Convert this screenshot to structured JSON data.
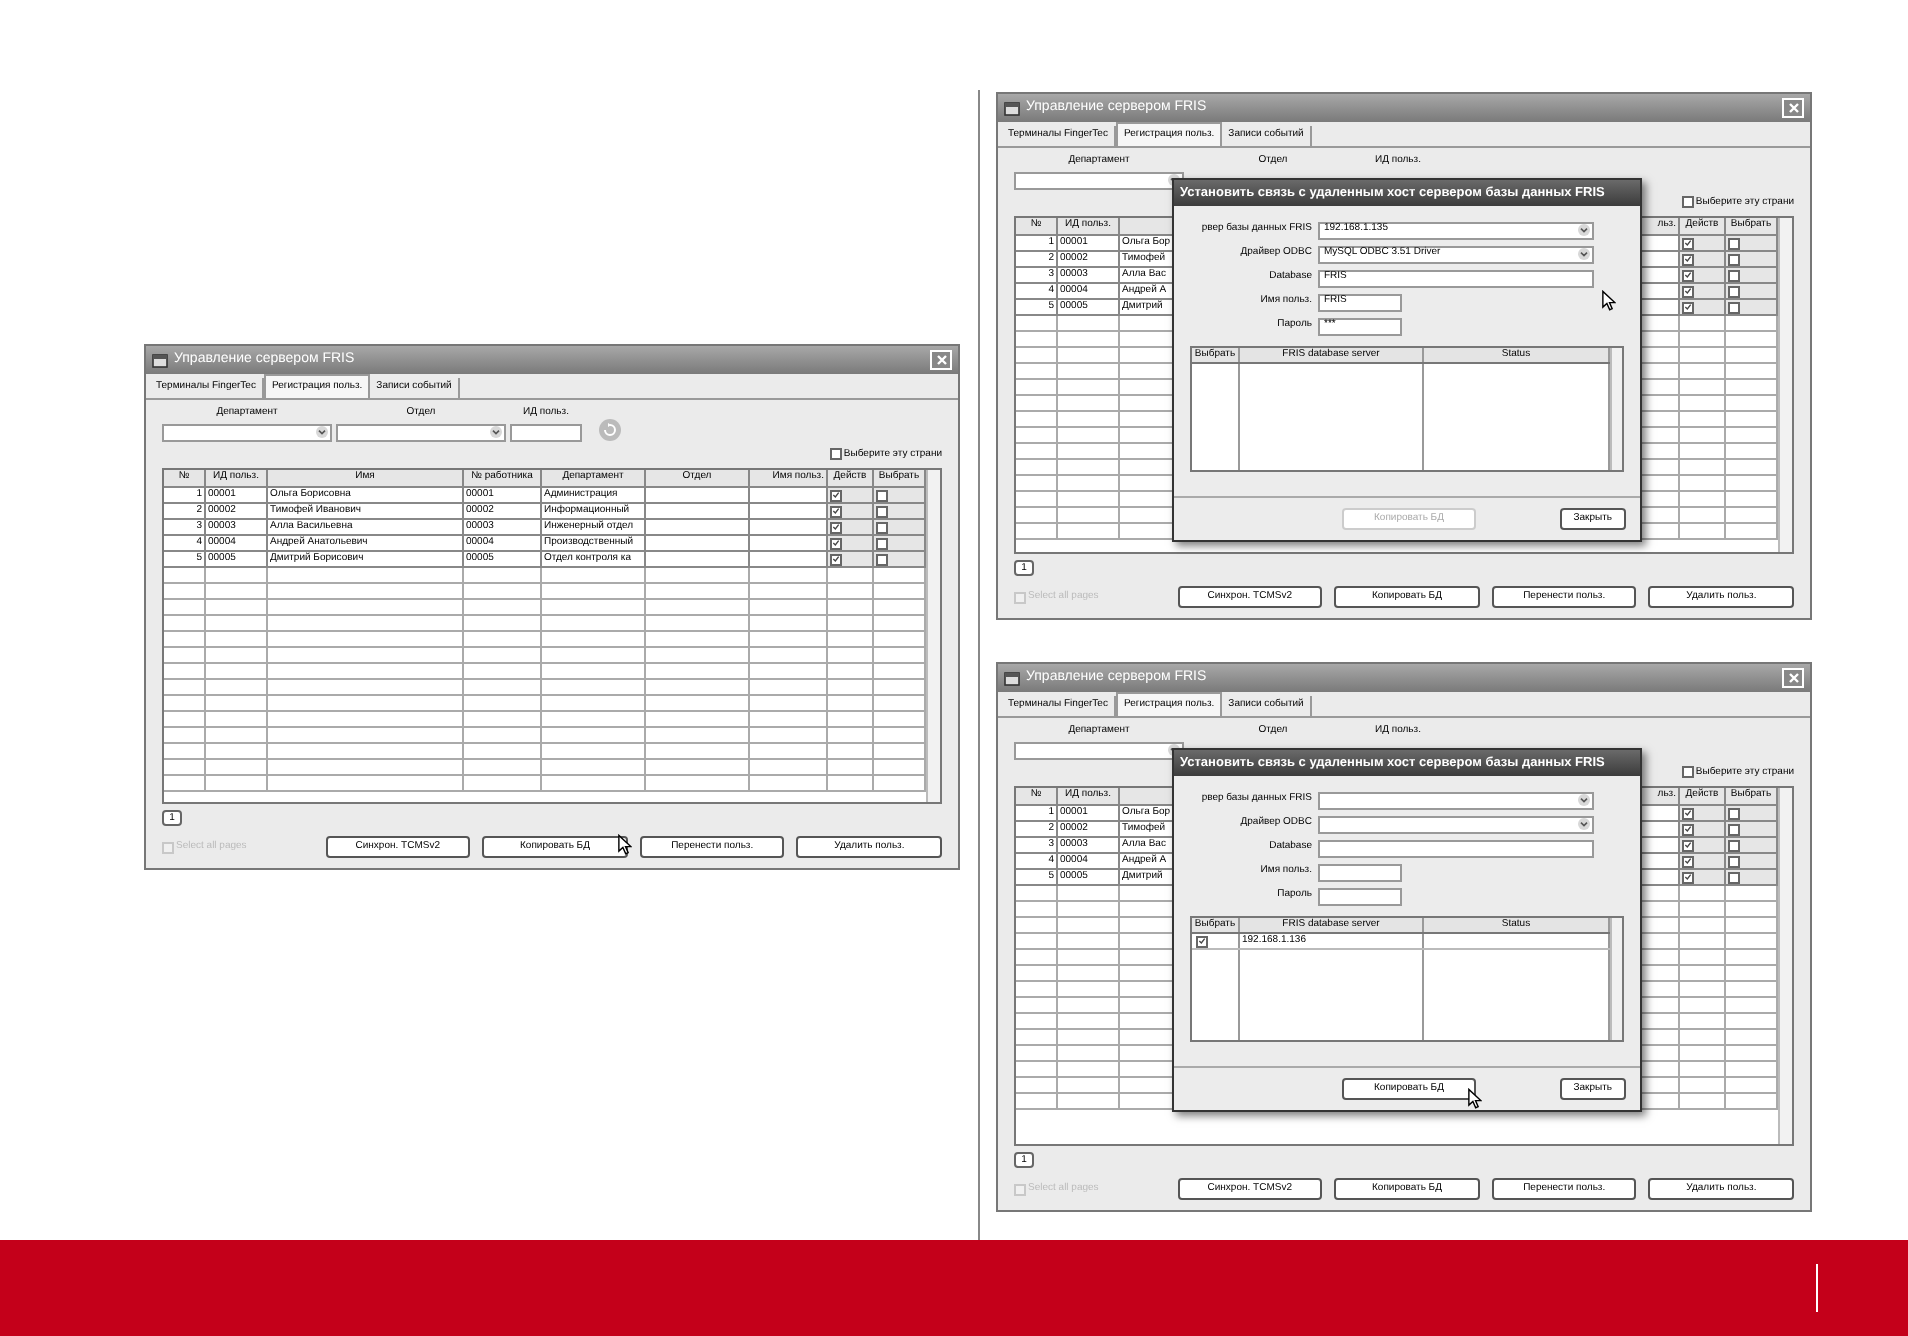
{
  "windows": [
    {
      "title": "Управление сервером FRIS",
      "tabs": [
        {
          "label": "Терминалы FingerTec",
          "selected": false
        },
        {
          "label": "Регистрация польз.",
          "selected": true
        },
        {
          "label": "Записи событий",
          "selected": false
        }
      ],
      "filters": {
        "department_label": "Департамент",
        "section_label": "Отдел",
        "user_id_label": "ИД польз."
      },
      "select_page": {
        "label": "Выберите эту страни",
        "checked": false
      },
      "table": {
        "columns": [
          {
            "label": "№"
          },
          {
            "label": "ИД польз."
          },
          {
            "label": "Имя"
          },
          {
            "label": "№ работника"
          },
          {
            "label": "Департамент"
          },
          {
            "label": "Отдел"
          },
          {
            "label": "Имя польз."
          },
          {
            "label": "Действ"
          },
          {
            "label": "Выбрать"
          }
        ],
        "rows": [
          {
            "no": "1",
            "id": "00001",
            "name": "Ольга Борисовна",
            "employee": "00001",
            "department": "Администрация",
            "checked": true,
            "selected": false
          },
          {
            "no": "2",
            "id": "00002",
            "name": "Тимофей Иванович",
            "employee": "00002",
            "department": "Информационный",
            "checked": true,
            "selected": false
          },
          {
            "no": "3",
            "id": "00003",
            "name": "Алла Васильевна",
            "employee": "00003",
            "department": "Инженерный отдел",
            "checked": true,
            "selected": false
          },
          {
            "no": "4",
            "id": "00004",
            "name": "Андрей Анатольевич",
            "employee": "00004",
            "department": "Производственный",
            "checked": true,
            "selected": false
          },
          {
            "no": "5",
            "id": "00005",
            "name": "Дмитрий Борисович",
            "employee": "00005",
            "department": "Отдел контроля ка",
            "checked": true,
            "selected": false
          }
        ]
      },
      "page_button": "1",
      "select_all": {
        "label": "Select all pages",
        "checked": false,
        "disabled": true
      },
      "buttons": [
        "Синхрон. TCMSv2",
        "Копировать БД",
        "Перенести польз.",
        "Удалить польз."
      ]
    },
    {
      "title": "Управление сервером FRIS",
      "tabs": [
        {
          "label": "Терминалы FingerTec",
          "selected": false
        },
        {
          "label": "Регистрация польз.",
          "selected": true
        },
        {
          "label": "Записи событий",
          "selected": false
        }
      ],
      "filters": {
        "department_label": "Департамент",
        "section_label": "Отдел",
        "user_id_label": "ИД польз."
      },
      "select_page": {
        "label": "Выберите эту страни",
        "checked": false
      },
      "table": {
        "columns": [
          {
            "label": "№"
          },
          {
            "label": "ИД польз."
          },
          {},
          {},
          {},
          {},
          {
            "label": "льз."
          },
          {
            "label": "Действ"
          },
          {
            "label": "Выбрать"
          }
        ],
        "rows": [
          {
            "no": "1",
            "id": "00001",
            "name": "Ольга Бор",
            "checked": true,
            "selected": false
          },
          {
            "no": "2",
            "id": "00002",
            "name": "Тимофей",
            "checked": true,
            "selected": false
          },
          {
            "no": "3",
            "id": "00003",
            "name": "Алла Вас",
            "checked": true,
            "selected": false
          },
          {
            "no": "4",
            "id": "00004",
            "name": "Андрей А",
            "checked": true,
            "selected": false
          },
          {
            "no": "5",
            "id": "00005",
            "name": "Дмитрий",
            "checked": true,
            "selected": false
          }
        ]
      },
      "page_button": "1",
      "select_all": {
        "label": "Select all pages",
        "checked": false,
        "disabled": true
      },
      "buttons": [
        "Синхрон. TCMSv2",
        "Копировать БД",
        "Перенести польз.",
        "Удалить польз."
      ],
      "dialog": {
        "title": "Установить связь с удаленным хост сервером базы данных FRIS",
        "fields": [
          {
            "kind": "combo",
            "label": "рвер базы данных FRIS",
            "value": "192.168.1.135"
          },
          {
            "kind": "combo",
            "label": "Драйвер ODBC",
            "value": "MySQL ODBC 3.51 Driver"
          },
          {
            "kind": "text",
            "label": "Database",
            "value": "FRIS"
          },
          {
            "kind": "short",
            "label": "Имя польз.",
            "value": "FRIS"
          },
          {
            "kind": "short",
            "label": "Пароль",
            "value": "***"
          }
        ],
        "grid": {
          "columns": [
            "Выбрать",
            "FRIS database server",
            "Status"
          ]
        },
        "buttons": [
          {
            "label": "Копировать БД",
            "disabled": true
          },
          {
            "label": "Закрыть",
            "disabled": false
          }
        ]
      }
    },
    {
      "title": "Управление сервером FRIS",
      "tabs": [
        {
          "label": "Терминалы FingerTec",
          "selected": false
        },
        {
          "label": "Регистрация польз.",
          "selected": true
        },
        {
          "label": "Записи событий",
          "selected": false
        }
      ],
      "filters": {
        "department_label": "Департамент",
        "section_label": "Отдел",
        "user_id_label": "ИД польз."
      },
      "select_page": {
        "label": "Выберите эту страни",
        "checked": false
      },
      "table": {
        "columns": [
          {
            "label": "№"
          },
          {
            "label": "ИД польз."
          },
          {},
          {},
          {},
          {},
          {
            "label": "льз."
          },
          {
            "label": "Действ"
          },
          {
            "label": "Выбрать"
          }
        ],
        "rows": [
          {
            "no": "1",
            "id": "00001",
            "name": "Ольга Бор",
            "checked": true,
            "selected": false
          },
          {
            "no": "2",
            "id": "00002",
            "name": "Тимофей",
            "checked": true,
            "selected": false
          },
          {
            "no": "3",
            "id": "00003",
            "name": "Алла Вас",
            "checked": true,
            "selected": false
          },
          {
            "no": "4",
            "id": "00004",
            "name": "Андрей А",
            "checked": true,
            "selected": false
          },
          {
            "no": "5",
            "id": "00005",
            "name": "Дмитрий",
            "checked": true,
            "selected": false
          }
        ]
      },
      "page_button": "1",
      "select_all": {
        "label": "Select all pages",
        "checked": false,
        "disabled": true
      },
      "buttons": [
        "Синхрон. TCMSv2",
        "Копировать БД",
        "Перенести польз.",
        "Удалить польз."
      ],
      "dialog": {
        "title": "Установить связь с удаленным хост сервером базы данных FRIS",
        "fields": [
          {
            "kind": "combo",
            "label": "рвер базы данных FRIS"
          },
          {
            "kind": "combo",
            "label": "Драйвер ODBC"
          },
          {
            "kind": "text",
            "label": "Database"
          },
          {
            "kind": "short",
            "label": "Имя польз."
          },
          {
            "kind": "short",
            "label": "Пароль"
          }
        ],
        "grid": {
          "columns": [
            "Выбрать",
            "FRIS database server",
            "Status"
          ],
          "rows": [
            {
              "checked": true,
              "server": "192.168.1.136"
            }
          ]
        },
        "buttons": [
          {
            "label": "Копировать БД",
            "disabled": false
          },
          {
            "label": "Закрыть",
            "disabled": false
          }
        ]
      }
    }
  ]
}
